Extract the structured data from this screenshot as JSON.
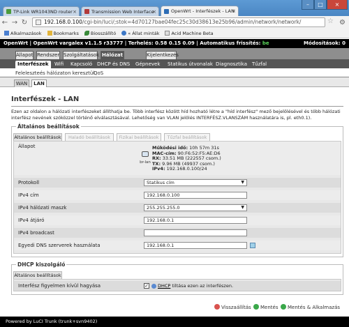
{
  "browser": {
    "tabs": [
      {
        "title": "TP-Link WR1043ND router",
        "active": false,
        "favicon_color": "#4b9b3b"
      },
      {
        "title": "Transmission Web Interface",
        "active": false,
        "favicon_color": "#b23a3a"
      },
      {
        "title": "OpenWrt - Interfészek - LAN",
        "active": true,
        "favicon_color": "#2d6db5"
      }
    ],
    "address": {
      "host": "192.168.0.100",
      "path": "/cgi-bin/luci/;stok=4d70127bae04fec25c30d38613e25b96/admin/network/network/"
    },
    "bookmarks": [
      {
        "label": "Alkalmazások",
        "icon": "apps-grid-icon"
      },
      {
        "label": "Bookmarks",
        "icon": "folder-icon"
      },
      {
        "label": "Biosszállító",
        "icon": "leaf-icon"
      },
      {
        "label": "« Állat minták",
        "icon": "globe-icon"
      },
      {
        "label": "Acid Machine Beta",
        "icon": "page-icon"
      }
    ]
  },
  "owrt": {
    "header": {
      "text": "OpenWrt | OpenWrt vargalex v1.1.5 r33777 | Terhelés: 0.58 0.15 0.09 | Automatikus frissítés:",
      "autorefresh": "be",
      "changes": "Módosítások: 0"
    },
    "menu": [
      "Állapot",
      "Rendszer",
      "Szolgáltatások",
      "Hálózat",
      "Kijelentkezés"
    ],
    "submenu": [
      "Interfészek",
      "Wifi",
      "Kapcsoló",
      "DHCP és DNS",
      "Gépnevek",
      "Statikus útvonalak",
      "Diagnosztika",
      "Tűzfal"
    ],
    "submenu2": [
      "Feleleszteés hálózaton keresztül",
      "QoS"
    ],
    "iface_tabs": [
      "WAN",
      "LAN"
    ],
    "title": "Interfészek - LAN",
    "description": "Ezen az oldalon a hálózati interfészeket állíthatja be. Több interfész között híd hozható létre a \"híd interfész\" mező bejelölésével és több hálózati interfész nevének szóközzel történő elválasztásával. Lehetőség van VLAN jelölés INTERFÉSZ.VLANSZÁM használatára is, pl. eth0.1).",
    "general": {
      "legend": "Általános beállítások",
      "tabs": [
        "Általános beállítások",
        "Haladó beállítások",
        "Fizikai beállítások",
        "Tűzfal beállítások"
      ],
      "state_label": "Állapot",
      "iface_name": "br-lan",
      "status": {
        "uptime_label": "Működési idő:",
        "uptime": "10h 57m 31s",
        "mac_label": "MAC-cím:",
        "mac": "90:F6:52:F5:AE:D6",
        "rx_label": "RX:",
        "rx": "33.51 MB (222557 csom.)",
        "tx_label": "TX:",
        "tx": "9.96 MB (49937 csom.)",
        "ipv4_label": "IPv4:",
        "ipv4": "192.168.0.100/24"
      },
      "fields": [
        {
          "label": "Protokoll",
          "value": "Statikus cím",
          "kind": "select"
        },
        {
          "label": "IPv4 cím",
          "value": "192.168.0.100",
          "kind": "text"
        },
        {
          "label": "IPv4 hálózati maszk",
          "value": "255.255.255.0",
          "kind": "select"
        },
        {
          "label": "IPv4 átjáró",
          "value": "192.168.0.1",
          "kind": "text"
        },
        {
          "label": "IPv4 broadcast",
          "value": "",
          "kind": "text"
        },
        {
          "label": "Egyedi DNS szerverek használata",
          "value": "192.168.0.1",
          "kind": "text"
        }
      ]
    },
    "dhcp": {
      "legend": "DHCP kiszolgáló",
      "tab": "Általános beállítások",
      "ignore_label": "Interfész figyelmen kívül hagyása",
      "checked": true,
      "help_link": "DHCP",
      "help_text": " tiltása ezen az interfészen."
    },
    "buttons": [
      {
        "label": "Visszaállítás",
        "color": "#d9534f"
      },
      {
        "label": "Mentés",
        "color": "#3aa84a"
      },
      {
        "label": "Mentés & Alkalmazás",
        "color": "#3aa84a"
      }
    ],
    "footer": "Powered by LuCI Trunk (trunk+svn9402)"
  }
}
